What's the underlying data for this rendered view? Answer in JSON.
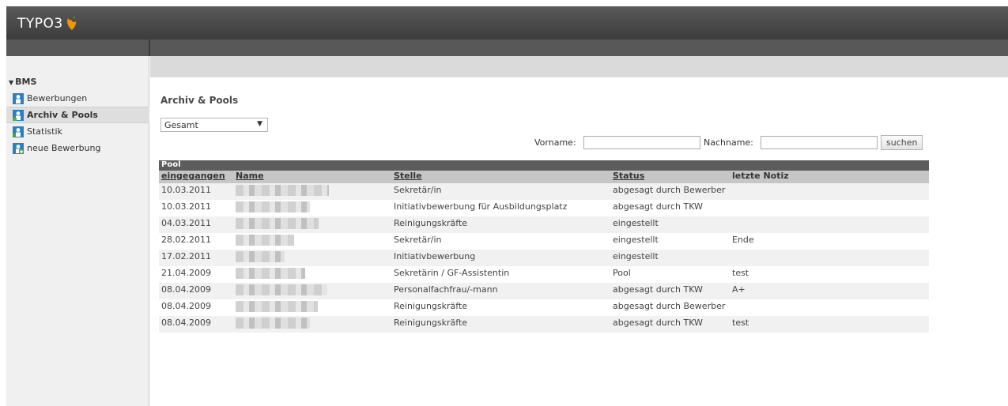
{
  "app": {
    "logo_text": "TYPO3"
  },
  "sidebar": {
    "group": "BMS",
    "items": [
      {
        "label": "Bewerbungen",
        "active": false
      },
      {
        "label": "Archiv & Pools",
        "active": true
      },
      {
        "label": "Statistik",
        "active": false
      },
      {
        "label": "neue Bewerbung",
        "active": false
      }
    ]
  },
  "main": {
    "title": "Archiv & Pools",
    "filter": {
      "selected": "Gesamt"
    },
    "search": {
      "vorname_label": "Vorname:",
      "vorname_value": "",
      "nachname_label": "Nachname:",
      "nachname_value": "",
      "button": "suchen"
    },
    "table": {
      "section": "Pool",
      "headers": [
        "eingegangen",
        "Name",
        "Stelle",
        "Status",
        "letzte Notiz"
      ],
      "rows": [
        {
          "date": "10.03.2011",
          "stelle": "Sekretär/in",
          "status": "abgesagt durch Bewerber",
          "notiz": ""
        },
        {
          "date": "10.03.2011",
          "stelle": "Initiativbewerbung für Ausbildungsplatz",
          "status": "abgesagt durch TKW",
          "notiz": ""
        },
        {
          "date": "04.03.2011",
          "stelle": "Reinigungskräfte",
          "status": "eingestellt",
          "notiz": ""
        },
        {
          "date": "28.02.2011",
          "stelle": "Sekretär/in",
          "status": "eingestellt",
          "notiz": "Ende"
        },
        {
          "date": "17.02.2011",
          "stelle": "Initiativbewerbung",
          "status": "eingestellt",
          "notiz": ""
        },
        {
          "date": "21.04.2009",
          "stelle": "Sekretärin / GF-Assistentin",
          "status": "Pool",
          "notiz": "test"
        },
        {
          "date": "08.04.2009",
          "stelle": "Personalfachfrau/-mann",
          "status": "abgesagt durch TKW",
          "notiz": "A+"
        },
        {
          "date": "08.04.2009",
          "stelle": "Reinigungskräfte",
          "status": "abgesagt durch Bewerber",
          "notiz": ""
        },
        {
          "date": "08.04.2009",
          "stelle": "Reinigungskräfte",
          "status": "abgesagt durch TKW",
          "notiz": "test"
        }
      ]
    }
  },
  "colors": {
    "topbar": "#4a4a4a",
    "logo_flame": "#f49700",
    "sidebar_bg": "#f0f0f0",
    "table_header": "#c6c6c6",
    "pool_bar": "#5c5c5c"
  }
}
